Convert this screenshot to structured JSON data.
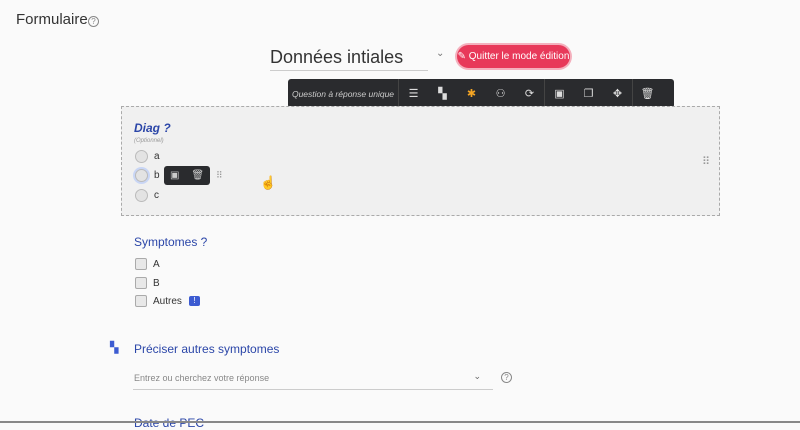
{
  "page": {
    "title": "Formulaire"
  },
  "form": {
    "title": "Données intiales",
    "quit_label": "Quitter le mode édition"
  },
  "toolbar": {
    "label": "Question à réponse unique"
  },
  "q1": {
    "label": "Diag ?",
    "optional": "(Optionnel)",
    "options": [
      "a",
      "b",
      "c"
    ]
  },
  "q2": {
    "label": "Symptomes ?",
    "options": [
      "A",
      "B",
      "Autres"
    ]
  },
  "q3": {
    "label": "Préciser autres symptomes",
    "placeholder": "Entrez ou cherchez votre réponse"
  },
  "q4": {
    "label": "Date de PEC"
  },
  "colors": {
    "accent": "#2b46a8",
    "danger": "#e8395a",
    "toolbar": "#2a2b2e"
  }
}
